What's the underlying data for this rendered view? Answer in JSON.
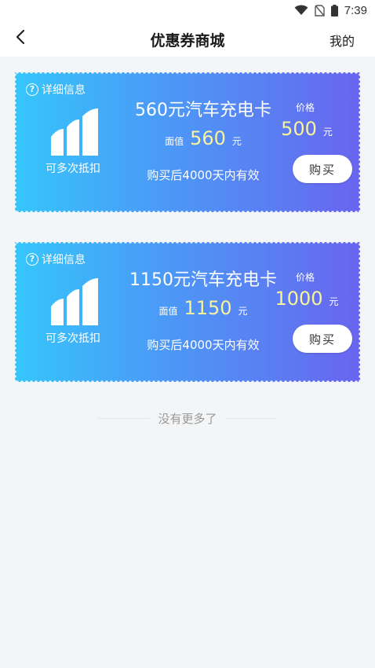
{
  "status_bar": {
    "time": "7:39",
    "icons": [
      "wifi-icon",
      "no-sim-icon",
      "battery-icon"
    ]
  },
  "nav": {
    "title": "优惠券商城",
    "right_link": "我的",
    "back_icon": "chevron-left-icon"
  },
  "coupons": [
    {
      "detail_label": "详细信息",
      "multi_use_label": "可多次抵扣",
      "title": "560元汽车充电卡",
      "face_label": "面值",
      "face_value": "560",
      "face_unit": "元",
      "validity": "购买后4000天内有效",
      "price_label": "价格",
      "price": "500",
      "price_unit": "元",
      "buy_label": "购买"
    },
    {
      "detail_label": "详细信息",
      "multi_use_label": "可多次抵扣",
      "title": "1150元汽车充电卡",
      "face_label": "面值",
      "face_value": "1150",
      "face_unit": "元",
      "validity": "购买后4000天内有效",
      "price_label": "价格",
      "price": "1000",
      "price_unit": "元",
      "buy_label": "购买"
    }
  ],
  "footer": {
    "no_more": "没有更多了"
  },
  "colors": {
    "gradient_start": "#35c6fb",
    "gradient_end": "#6a64ef",
    "highlight_value": "#f9f39a",
    "background": "#f4f5f7"
  }
}
